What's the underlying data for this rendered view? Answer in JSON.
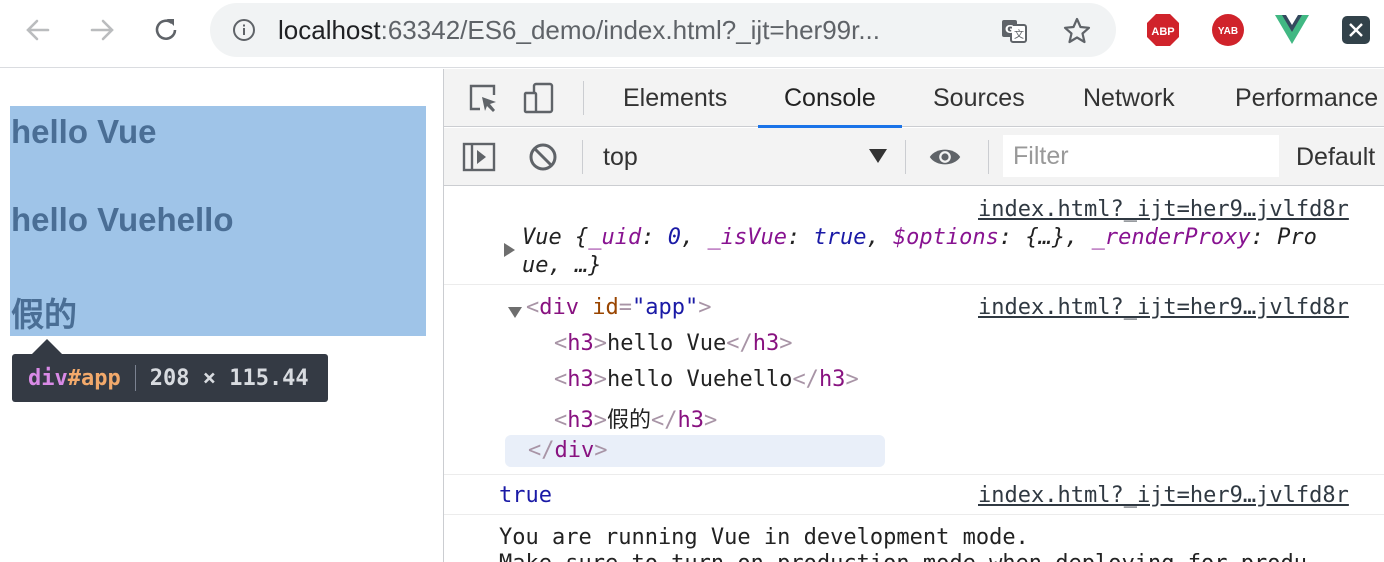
{
  "browser": {
    "url_host": "localhost",
    "url_rest": ":63342/ES6_demo/index.html?_ijt=her99r...",
    "extensions": [
      {
        "name": "adblock-plus",
        "label": "ABP",
        "color": "#d0232b"
      },
      {
        "name": "yab",
        "label": "YAB",
        "color": "#d0232b"
      },
      {
        "name": "vue-devtools",
        "label": "",
        "color": "#41b883"
      },
      {
        "name": "x-extension",
        "label": "X",
        "color": "#32424a"
      }
    ]
  },
  "page": {
    "headings": [
      "hello Vue",
      "hello Vuehello",
      "假的"
    ],
    "tooltip": {
      "tag": "div",
      "id": "#app",
      "dims": "208 × 115.44"
    },
    "highlight_color": "#9fc4e8"
  },
  "devtools": {
    "tabs": [
      "Elements",
      "Console",
      "Sources",
      "Network",
      "Performance"
    ],
    "active_tab": "Console",
    "context": "top",
    "filter_placeholder": "Filter",
    "levels": "Default",
    "messages": {
      "vue_instance": {
        "source": "index.html?_ijt=her9…jvlfd8r",
        "line1_prefix": "Vue {",
        "k_uid": "_uid",
        "v_uid": "0",
        "k_isVue": "_isVue",
        "v_isVue": "true",
        "k_options": "$options",
        "v_options": "{…}",
        "k_render": "_renderProxy",
        "v_render": "Pro",
        "line2": "ue, …}"
      },
      "element": {
        "source": "index.html?_ijt=her9…jvlfd8r",
        "open_tag": "div",
        "attr_name": "id",
        "attr_value": "\"app\"",
        "children": [
          "hello Vue",
          "hello Vuehello",
          "假的"
        ],
        "child_tag": "h3"
      },
      "bool_result": {
        "source": "index.html?_ijt=her9…jvlfd8r",
        "value": "true"
      },
      "dev_mode": {
        "line1": "You are running Vue in development mode.",
        "line2": "Make sure to turn on production mode when deploying for produ"
      }
    }
  }
}
